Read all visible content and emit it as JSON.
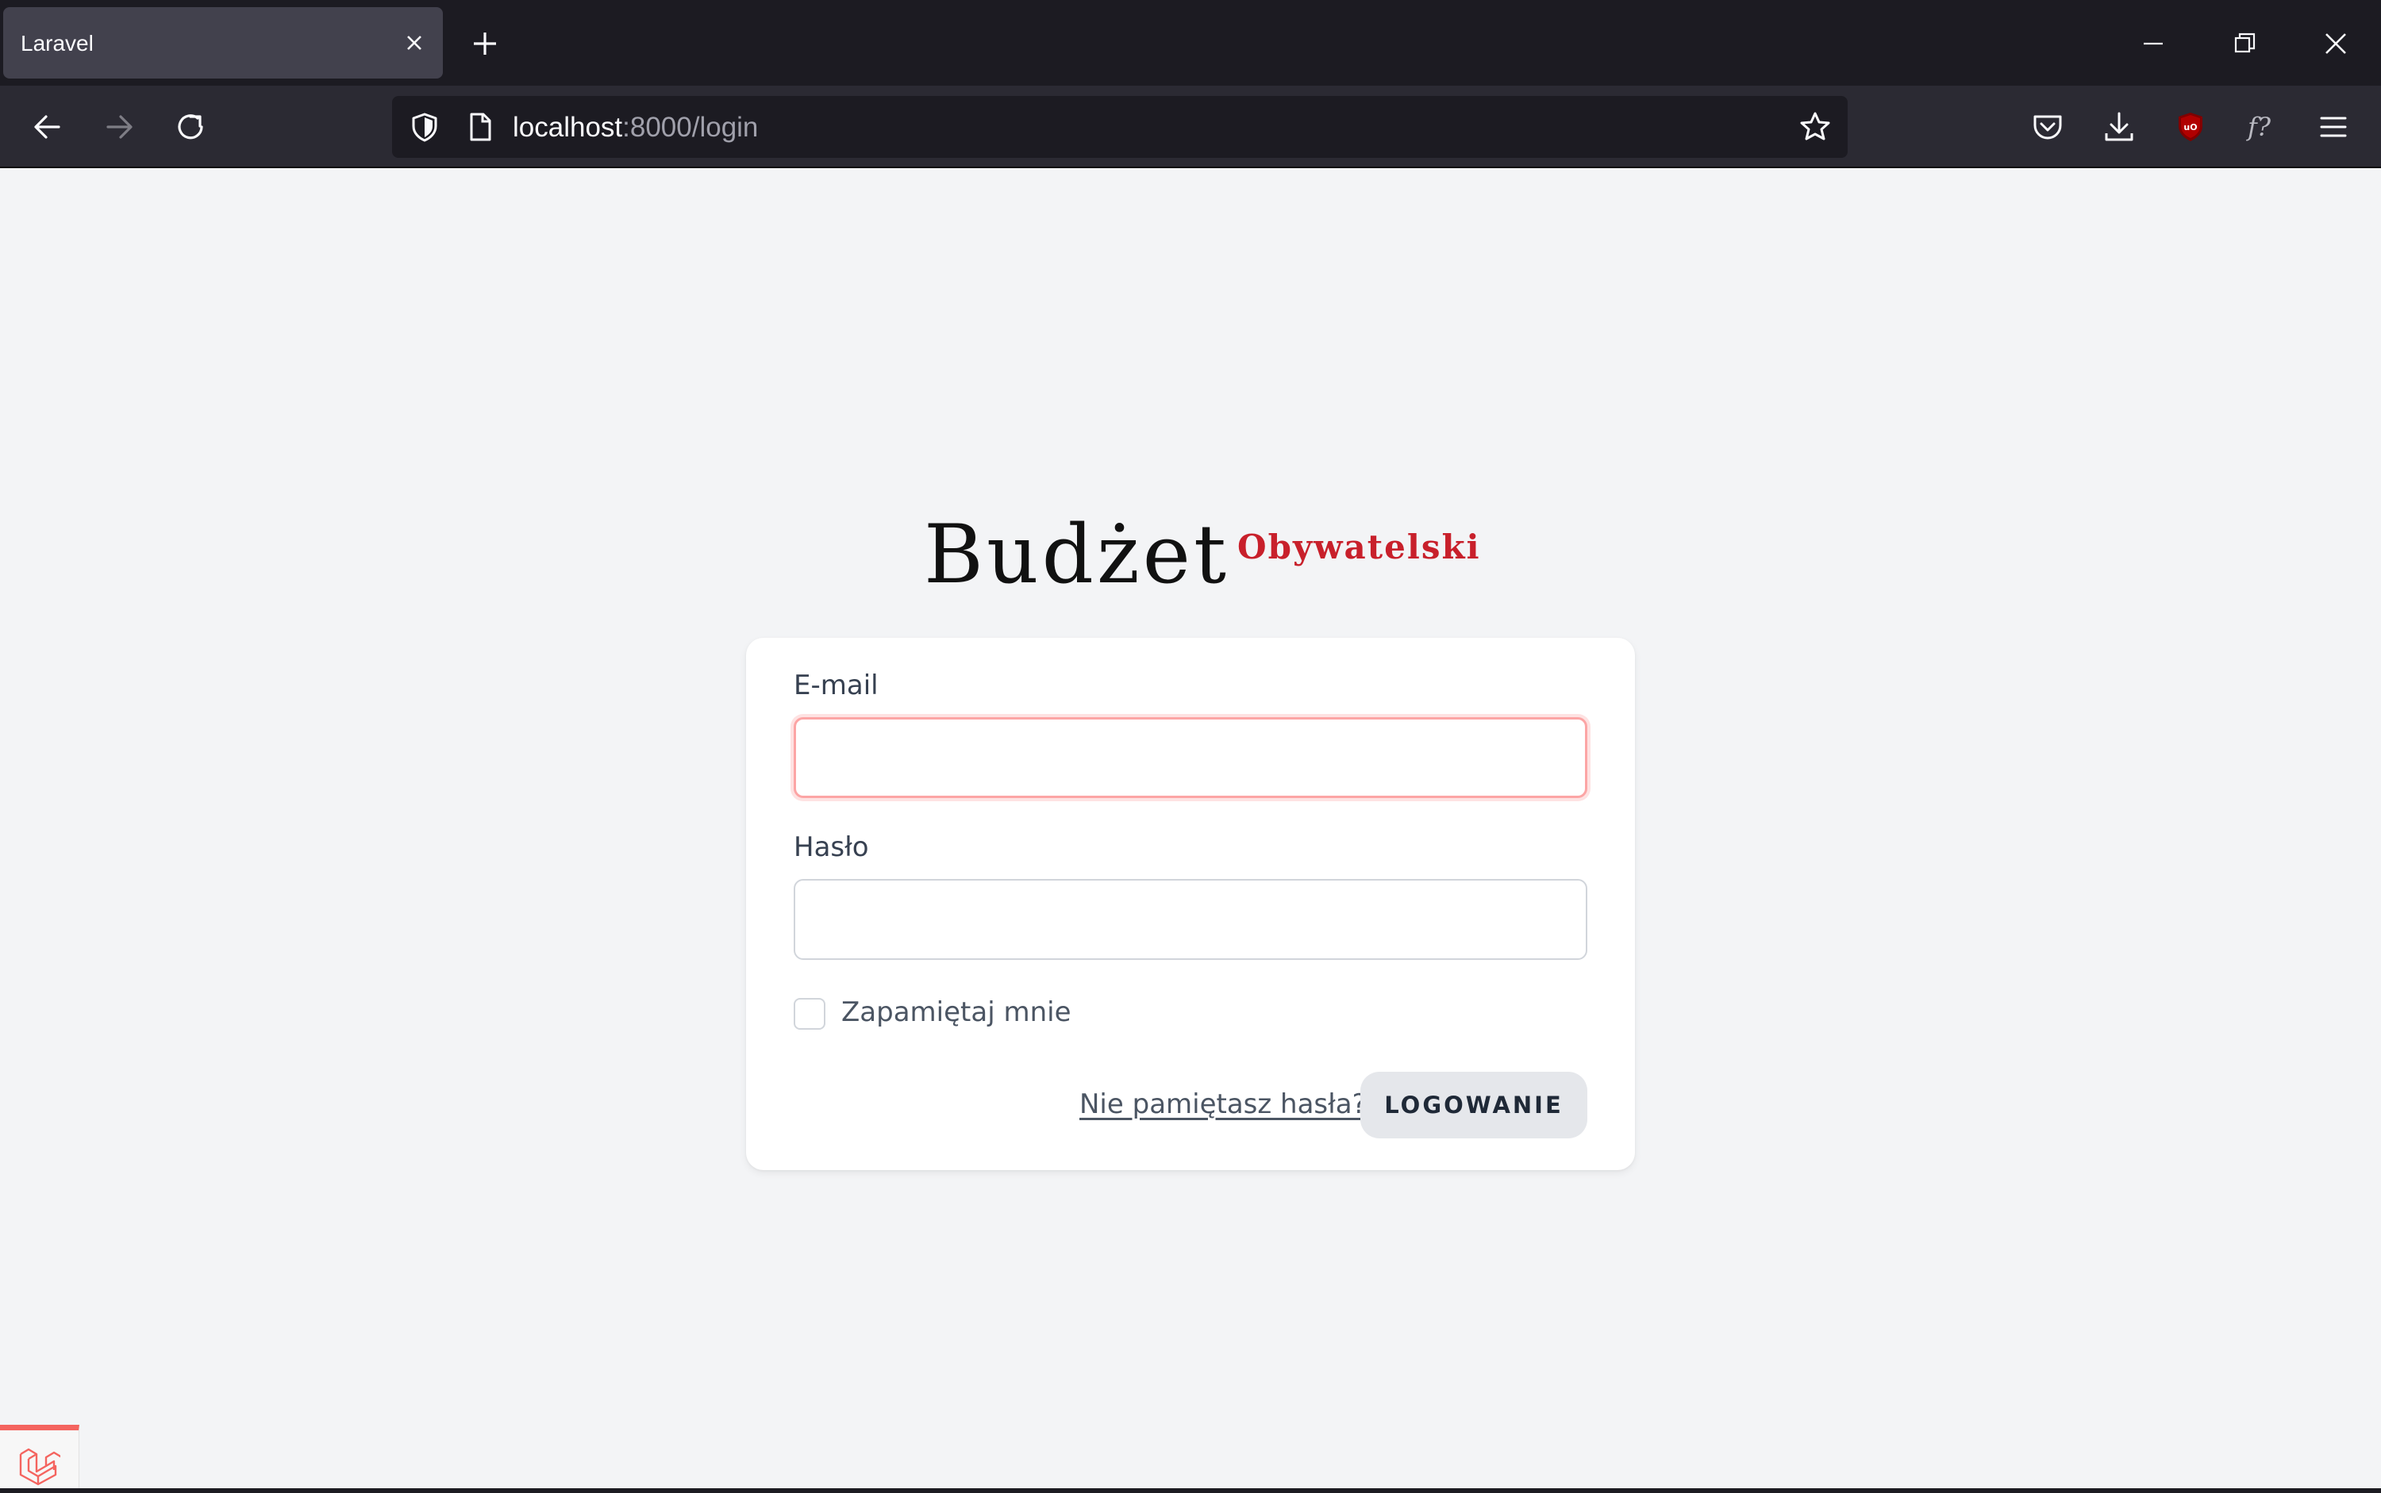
{
  "browser": {
    "tab_title": "Laravel",
    "url_host": "localhost",
    "url_path": ":8000/login"
  },
  "logo": {
    "main": "Budżet",
    "sub": "Obywatelski",
    "accent_color": "#c8202b"
  },
  "form": {
    "email_label": "E-mail",
    "email_value": "",
    "password_label": "Hasło",
    "password_value": "",
    "remember_label": "Zapamiętaj mnie",
    "remember_checked": false,
    "forgot_link": "Nie pamiętasz hasła?",
    "submit_label": "LOGOWANIE"
  },
  "icons": {
    "tab_close": "close-icon",
    "new_tab": "plus-icon",
    "minimize": "minimize-icon",
    "restore": "restore-icon",
    "close_window": "close-icon",
    "back": "back-arrow-icon",
    "forward": "forward-arrow-icon",
    "reload": "reload-icon",
    "tracking": "shield-icon",
    "page": "page-icon",
    "bookmark": "star-icon",
    "pocket": "pocket-icon",
    "downloads": "download-icon",
    "ublock": "ublock-icon",
    "fonts_ext": "font-finder-icon",
    "menu": "hamburger-menu-icon",
    "debugbar": "laravel-logo-icon"
  }
}
